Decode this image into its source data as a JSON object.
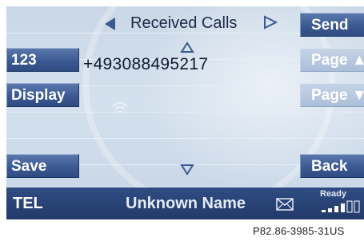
{
  "header": {
    "title": "Received Calls"
  },
  "entry": {
    "number": "+493088495217"
  },
  "left_softkeys": [
    "123",
    "Display",
    "Save"
  ],
  "right_softkeys": {
    "send": "Send",
    "page_up": "Page ▲",
    "page_down": "Page ▼",
    "back": "Back"
  },
  "status": {
    "mode": "TEL",
    "name": "Unknown Name",
    "ready": "Ready"
  },
  "icons": [
    "left-arrow-icon",
    "right-arrow-icon",
    "up-arrow-icon",
    "down-arrow-icon",
    "wireless-icon",
    "envelope-icon",
    "signal-strength-icon"
  ],
  "caption": "P82.86-3985-31US",
  "colors": {
    "button": "#3b5a92",
    "statusbar": "#2f4c82",
    "screen": "#c9d7e7",
    "text": "#1a2a45"
  }
}
